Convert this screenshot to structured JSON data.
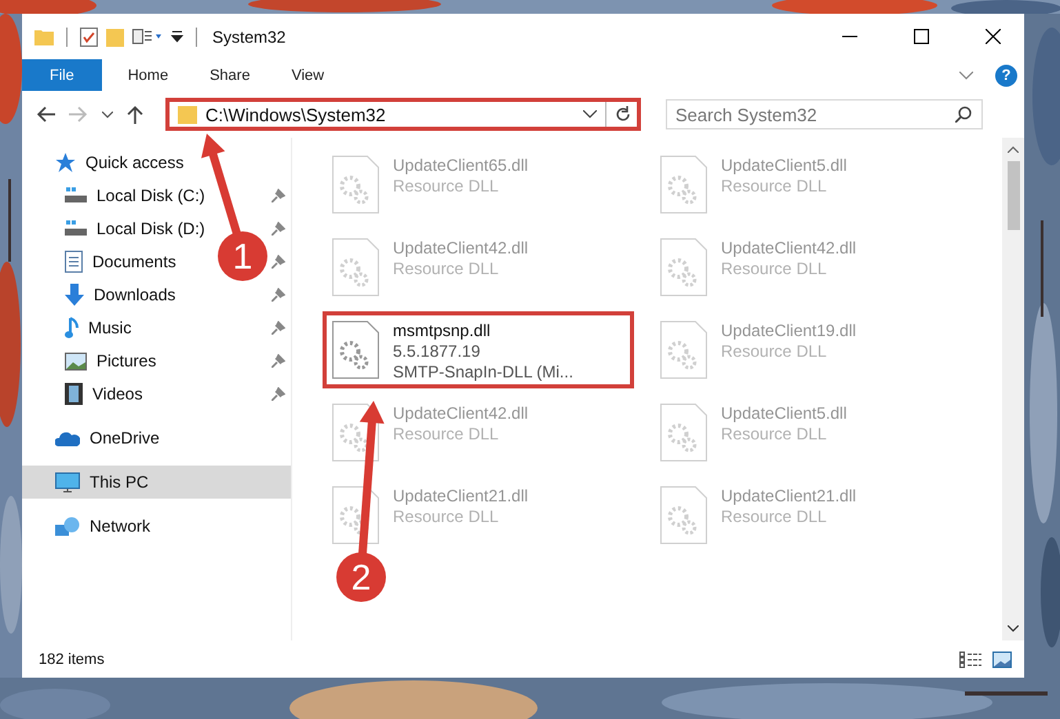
{
  "window": {
    "title": "System32"
  },
  "ribbon": {
    "tabs": [
      {
        "label": "File",
        "kind": "file"
      },
      {
        "label": "Home",
        "kind": "tab"
      },
      {
        "label": "Share",
        "kind": "tab"
      },
      {
        "label": "View",
        "kind": "tab"
      }
    ],
    "help": "?"
  },
  "address": {
    "path": "C:\\Windows\\System32",
    "highlighted": true
  },
  "search": {
    "placeholder": "Search System32"
  },
  "nav": [
    {
      "label": "Quick access",
      "kind": "star",
      "selected": false,
      "children": [
        {
          "label": "Local Disk (C:)",
          "kind": "drive",
          "pinned": true,
          "selected": false
        },
        {
          "label": "Local Disk (D:)",
          "kind": "drive",
          "pinned": true,
          "selected": false
        },
        {
          "label": "Documents",
          "kind": "document",
          "pinned": true,
          "selected": false
        },
        {
          "label": "Downloads",
          "kind": "download",
          "pinned": true,
          "selected": false
        },
        {
          "label": "Music",
          "kind": "music",
          "pinned": true,
          "selected": false
        },
        {
          "label": "Pictures",
          "kind": "pictures",
          "pinned": true,
          "selected": false
        },
        {
          "label": "Videos",
          "kind": "videos",
          "pinned": true,
          "selected": false
        }
      ]
    },
    {
      "label": "OneDrive",
      "kind": "cloud",
      "selected": false
    },
    {
      "label": "This PC",
      "kind": "pc",
      "selected": true
    },
    {
      "label": "Network",
      "kind": "network",
      "selected": false
    }
  ],
  "files": [
    {
      "name": "UpdateClient65.dll",
      "details": [
        "Resource DLL"
      ],
      "faded": true,
      "highlighted": false
    },
    {
      "name": "UpdateClient5.dll",
      "details": [
        "Resource DLL"
      ],
      "faded": true,
      "highlighted": false
    },
    {
      "name": "UpdateClient42.dll",
      "details": [
        "Resource DLL"
      ],
      "faded": true,
      "highlighted": false
    },
    {
      "name": "UpdateClient42.dll",
      "details": [
        "Resource DLL"
      ],
      "faded": true,
      "highlighted": false
    },
    {
      "name": "msmtpsnp.dll",
      "details": [
        "5.5.1877.19",
        "SMTP-SnapIn-DLL (Mi..."
      ],
      "faded": false,
      "highlighted": true
    },
    {
      "name": "UpdateClient19.dll",
      "details": [
        "Resource DLL"
      ],
      "faded": true,
      "highlighted": false
    },
    {
      "name": "UpdateClient42.dll",
      "details": [
        "Resource DLL"
      ],
      "faded": true,
      "highlighted": false
    },
    {
      "name": "UpdateClient5.dll",
      "details": [
        "Resource DLL"
      ],
      "faded": true,
      "highlighted": false
    },
    {
      "name": "UpdateClient21.dll",
      "details": [
        "Resource DLL"
      ],
      "faded": true,
      "highlighted": false
    },
    {
      "name": "UpdateClient21.dll",
      "details": [
        "Resource DLL"
      ],
      "faded": true,
      "highlighted": false
    }
  ],
  "status_bar": {
    "count": "182 items"
  },
  "annotations": [
    {
      "number": "1"
    },
    {
      "number": "2"
    }
  ]
}
